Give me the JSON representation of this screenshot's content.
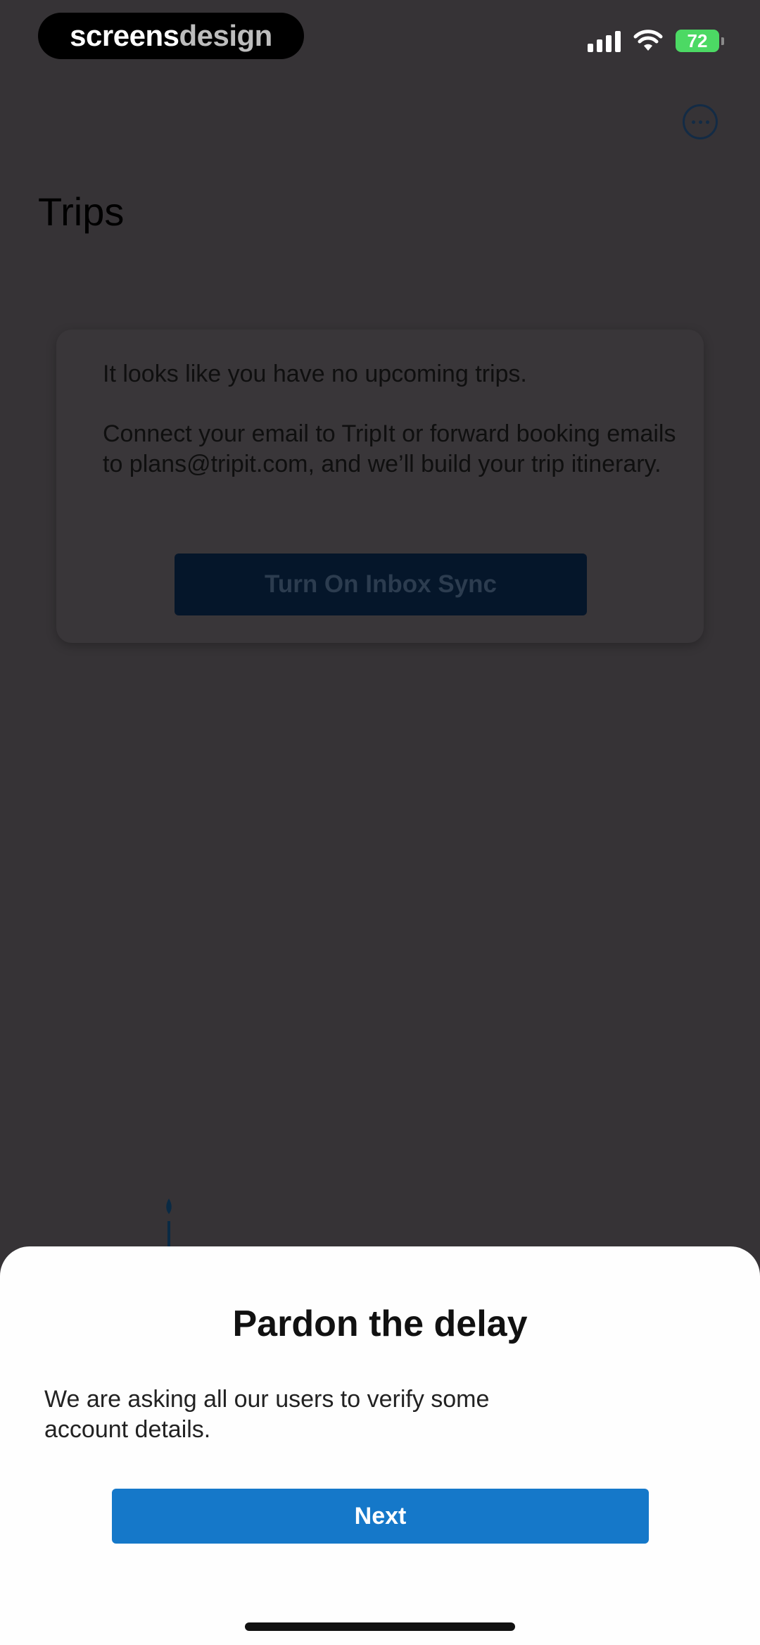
{
  "status_bar": {
    "brand_part1": "screens",
    "brand_part2": "design",
    "battery_level": "72"
  },
  "header": {
    "title": "Trips",
    "more_icon": "ellipsis-circle-icon"
  },
  "empty_card": {
    "message_1": "It looks like you have no upcoming trips.",
    "message_2": "Connect your email to TripIt or forward booking emails to plans@tripit.com, and we’ll build your trip itinerary.",
    "button_label": "Turn On Inbox Sync"
  },
  "sheet": {
    "title": "Pardon the delay",
    "body": "We are asking all our users to verify some account details.",
    "button_label": "Next"
  },
  "colors": {
    "background_dim": "#363336",
    "primary": "#1578c9",
    "battery": "#4cd964"
  }
}
